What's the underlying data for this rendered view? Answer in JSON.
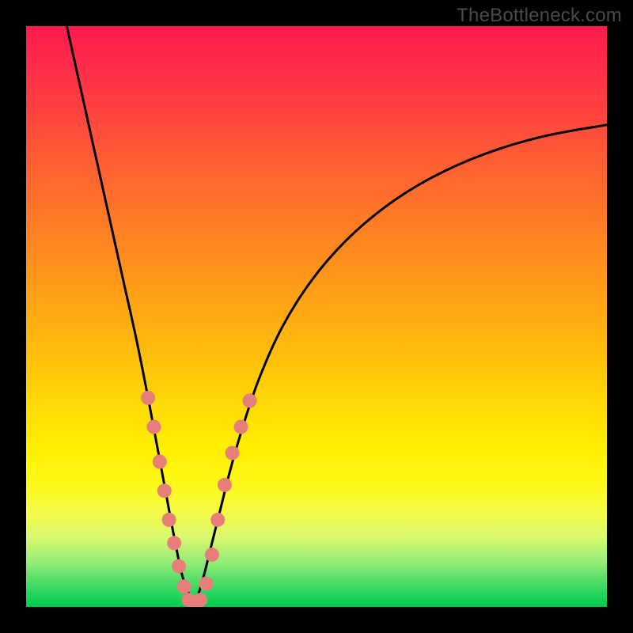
{
  "credit_text": "TheBottleneck.com",
  "chart_data": {
    "type": "line",
    "title": "",
    "xlabel": "",
    "ylabel": "",
    "xlim": [
      0,
      100
    ],
    "ylim": [
      0,
      100
    ],
    "grid": false,
    "series": [
      {
        "name": "left-branch",
        "x": [
          7,
          9,
          11,
          13,
          15,
          17,
          19,
          21,
          22.5,
          24,
          25.5,
          27,
          29
        ],
        "y": [
          100,
          91,
          82,
          73,
          64,
          55,
          46,
          36,
          28,
          20,
          12,
          5,
          0
        ]
      },
      {
        "name": "right-branch",
        "x": [
          29,
          30.5,
          32,
          33.5,
          35,
          37,
          40,
          44,
          49,
          55,
          62,
          70,
          79,
          89,
          100
        ],
        "y": [
          0,
          5,
          11,
          17,
          23,
          30,
          39,
          48,
          56,
          63,
          69,
          74,
          78,
          81,
          83
        ]
      }
    ],
    "markers": {
      "name": "highlight-dots",
      "color": "#e77e79",
      "radius": 9,
      "points": [
        {
          "x": 21.0,
          "y": 36.0
        },
        {
          "x": 22.0,
          "y": 31.0
        },
        {
          "x": 23.0,
          "y": 25.0
        },
        {
          "x": 23.8,
          "y": 20.0
        },
        {
          "x": 24.6,
          "y": 15.0
        },
        {
          "x": 25.5,
          "y": 11.0
        },
        {
          "x": 26.3,
          "y": 7.0
        },
        {
          "x": 27.2,
          "y": 3.5
        },
        {
          "x": 28.0,
          "y": 1.2
        },
        {
          "x": 29.0,
          "y": 0.5
        },
        {
          "x": 30.0,
          "y": 1.2
        },
        {
          "x": 31.0,
          "y": 4.0
        },
        {
          "x": 32.0,
          "y": 9.0
        },
        {
          "x": 33.0,
          "y": 15.0
        },
        {
          "x": 34.2,
          "y": 21.0
        },
        {
          "x": 35.5,
          "y": 26.5
        },
        {
          "x": 37.0,
          "y": 31.0
        },
        {
          "x": 38.5,
          "y": 35.5
        }
      ]
    }
  }
}
